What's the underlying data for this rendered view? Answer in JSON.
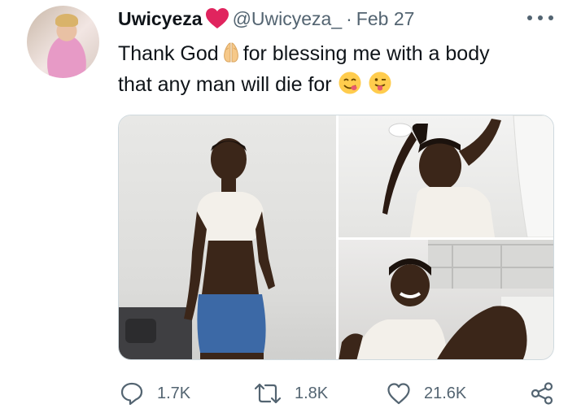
{
  "author": {
    "display_name": "Uwicyeza",
    "handle": "@Uwicyeza_",
    "separator": "·",
    "date": "Feb 27"
  },
  "tweet": {
    "line1_part1": "Thank God",
    "line1_part2": "for blessing me with a body",
    "line2": "that any man will die for"
  },
  "icons": {
    "name_emoji": "red-heart-icon",
    "text_emoji_1": "folded-hands-icon",
    "text_emoji_2": "face-savoring-food-icon",
    "text_emoji_3": "tongue-out-face-icon",
    "more": "more-icon",
    "reply": "reply-icon",
    "retweet": "retweet-icon",
    "like": "like-icon",
    "share": "share-icon"
  },
  "actions": {
    "replies": "1.7K",
    "retweets": "1.8K",
    "likes": "21.6K"
  },
  "colors": {
    "text": "#0f1419",
    "secondary": "#536471",
    "heart": "#e0245e"
  }
}
